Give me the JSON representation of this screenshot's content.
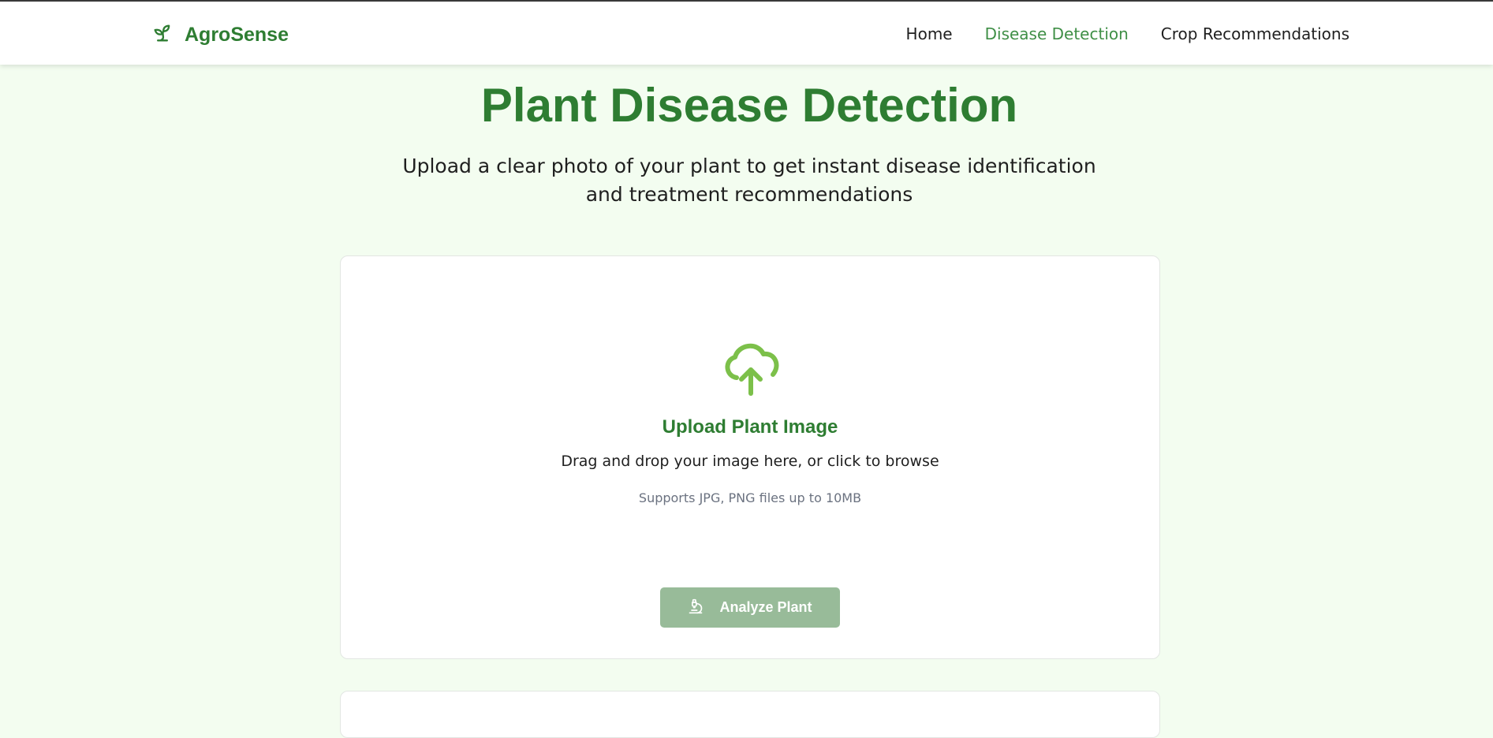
{
  "header": {
    "brand_name": "AgroSense",
    "brand_icon": "sprout-icon",
    "nav": [
      {
        "label": "Home",
        "active": false
      },
      {
        "label": "Disease Detection",
        "active": true
      },
      {
        "label": "Crop Recommendations",
        "active": false
      }
    ]
  },
  "hero": {
    "title": "Plant Disease Detection",
    "subtitle": "Upload a clear photo of your plant to get instant disease identification and treatment recommendations"
  },
  "upload": {
    "icon": "cloud-upload-icon",
    "title": "Upload Plant Image",
    "description": "Drag and drop your image here, or click to browse",
    "hint": "Supports JPG, PNG files up to 10MB"
  },
  "actions": {
    "analyze_label": "Analyze Plant",
    "analyze_icon": "microscope-icon",
    "analyze_enabled": false
  },
  "colors": {
    "brand": "#2e7d32",
    "nav_active": "#3f8f46",
    "page_bg": "#f3fdf0",
    "upload_icon": "#7cc04a",
    "button_disabled": "#98bb99"
  }
}
